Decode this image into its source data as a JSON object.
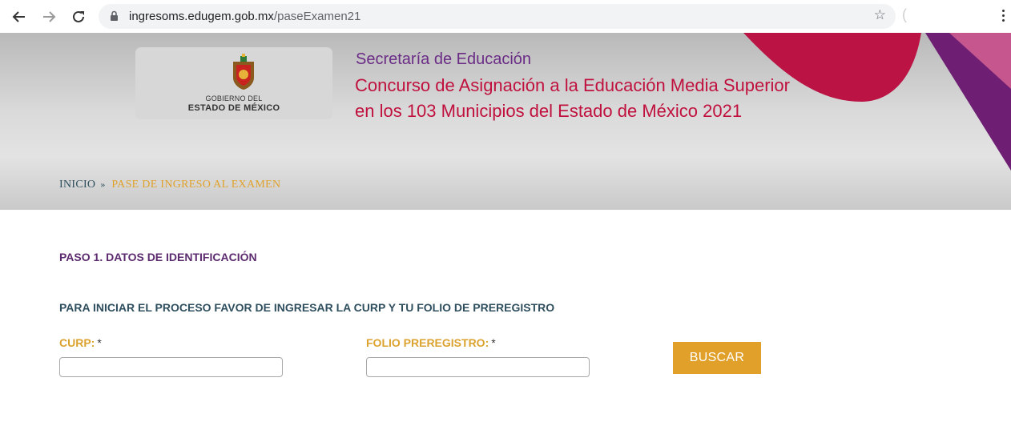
{
  "browser": {
    "url_host": "ingresoms.edugem.gob.mx",
    "url_path": "/paseExamen21",
    "icons": [
      "back-arrow-icon",
      "forward-arrow-icon",
      "reload-icon",
      "lock-icon",
      "star-icon",
      "menu-dots-icon"
    ]
  },
  "header": {
    "logo_line1": "GOBIERNO DEL",
    "logo_line2": "ESTADO DE MÉXICO",
    "subtitle": "Secretaría de Educación",
    "title_line1": "Concurso de Asignación a la Educación Media Superior",
    "title_line2": "en los 103 Municipios del Estado de México 2021"
  },
  "breadcrumb": {
    "home": "INICIO",
    "separator": "»",
    "current": "PASE DE INGRESO AL EXAMEN"
  },
  "form": {
    "step_title": "PASO 1. DATOS DE IDENTIFICACIÓN",
    "instructions": "PARA INICIAR EL PROCESO FAVOR DE INGRESAR LA CURP Y TU FOLIO DE PREREGISTRO",
    "curp_label": "CURP:",
    "curp_value": "",
    "folio_label": "FOLIO PREREGISTRO:",
    "folio_value": "",
    "required_mark": "*",
    "submit_label": "BUSCAR"
  },
  "colors": {
    "accent_gold": "#e0a02a",
    "title_red": "#c0113e",
    "purple": "#6b2c86",
    "dark_teal": "#2f4f5f"
  }
}
